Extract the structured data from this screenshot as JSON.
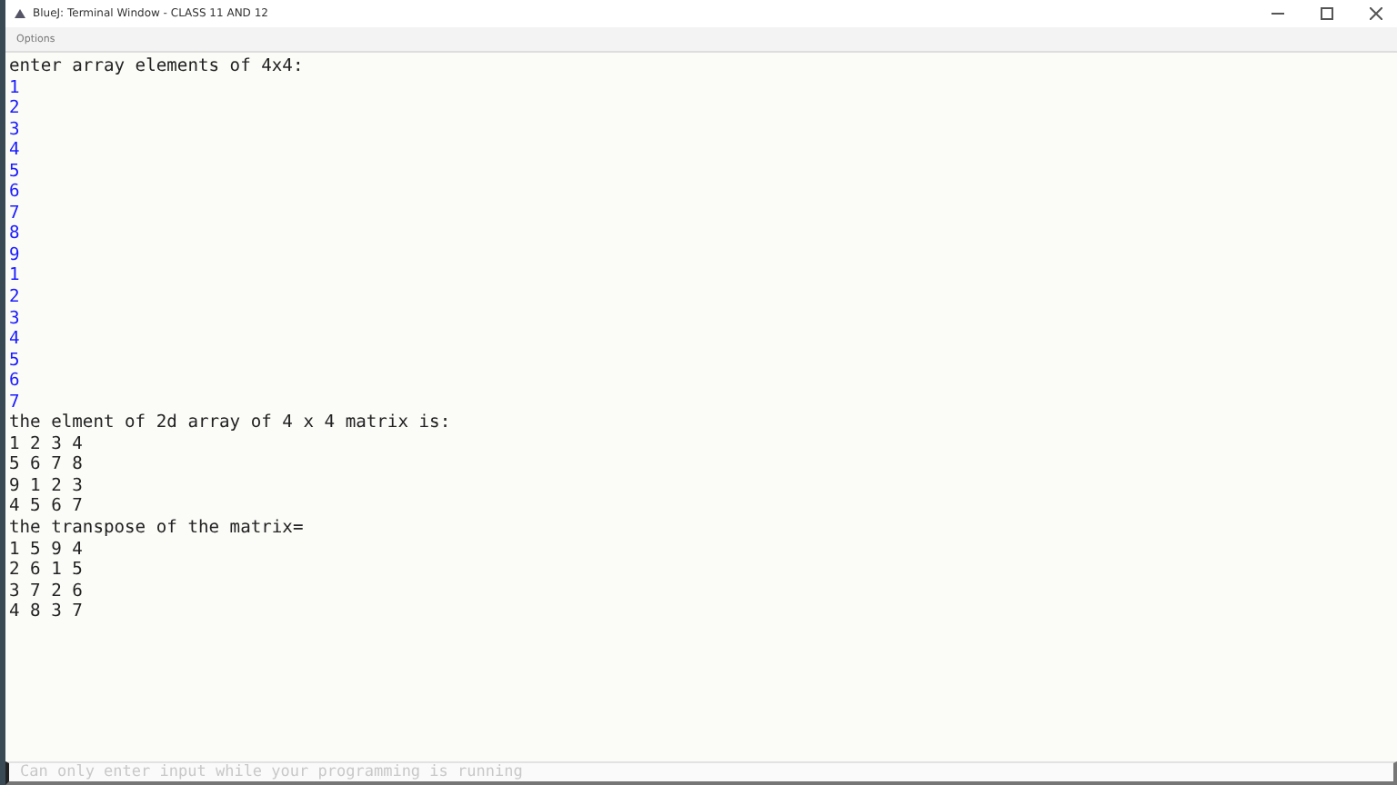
{
  "window": {
    "title": "BlueJ: Terminal Window - CLASS  11 AND 12"
  },
  "menu": [
    "Options"
  ],
  "terminal": {
    "lines": [
      {
        "kind": "output",
        "text": "enter array elements of 4x4:"
      },
      {
        "kind": "input",
        "text": "1"
      },
      {
        "kind": "input",
        "text": "2"
      },
      {
        "kind": "input",
        "text": "3"
      },
      {
        "kind": "input",
        "text": "4"
      },
      {
        "kind": "input",
        "text": "5"
      },
      {
        "kind": "input",
        "text": "6"
      },
      {
        "kind": "input",
        "text": "7"
      },
      {
        "kind": "input",
        "text": "8"
      },
      {
        "kind": "input",
        "text": "9"
      },
      {
        "kind": "input",
        "text": "1"
      },
      {
        "kind": "input",
        "text": "2"
      },
      {
        "kind": "input",
        "text": "3"
      },
      {
        "kind": "input",
        "text": "4"
      },
      {
        "kind": "input",
        "text": "5"
      },
      {
        "kind": "input",
        "text": "6"
      },
      {
        "kind": "input",
        "text": "7"
      },
      {
        "kind": "output",
        "text": "the elment of 2d array of 4 x 4 matrix is:"
      },
      {
        "kind": "output",
        "text": "1 2 3 4"
      },
      {
        "kind": "output",
        "text": "5 6 7 8"
      },
      {
        "kind": "output",
        "text": "9 1 2 3"
      },
      {
        "kind": "output",
        "text": "4 5 6 7"
      },
      {
        "kind": "output",
        "text": "the transpose of the matrix="
      },
      {
        "kind": "output",
        "text": "1 5 9 4"
      },
      {
        "kind": "output",
        "text": "2 6 1 5"
      },
      {
        "kind": "output",
        "text": "3 7 2 6"
      },
      {
        "kind": "output",
        "text": "4 8 3 7"
      }
    ]
  },
  "input": {
    "placeholder": "Can only enter input while your programming is running"
  }
}
